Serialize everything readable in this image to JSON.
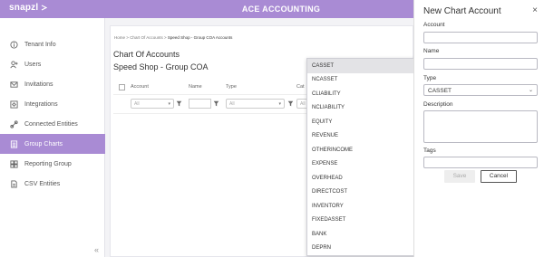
{
  "app": {
    "logo_text": "snapzl",
    "title": "ACE ACCOUNTING"
  },
  "sidebar": {
    "items": [
      {
        "label": "Tenant Info",
        "icon": "info-circle-icon"
      },
      {
        "label": "Users",
        "icon": "users-icon"
      },
      {
        "label": "Invitations",
        "icon": "invite-icon"
      },
      {
        "label": "Integrations",
        "icon": "integrations-icon"
      },
      {
        "label": "Connected Entities",
        "icon": "link-icon"
      },
      {
        "label": "Group Charts",
        "icon": "chart-list-icon",
        "active": true
      },
      {
        "label": "Reporting Group",
        "icon": "reporting-group-icon"
      },
      {
        "label": "CSV Entities",
        "icon": "csv-icon"
      }
    ],
    "collapse_glyph": "«",
    "active_color": "#a98bd4"
  },
  "breadcrumb": {
    "items": [
      "Home",
      "Chart Of Accounts",
      "Speed Shop - Group COA Accounts"
    ],
    "separator": ">"
  },
  "main": {
    "title": "Chart Of Accounts",
    "subtitle": "Speed Shop - Group COA",
    "columns": [
      "Account",
      "Name",
      "Type",
      "Cat"
    ],
    "filter_all": "All"
  },
  "dropdown": {
    "options": [
      "CASSET",
      "NCASSET",
      "CLIABILITY",
      "NCLIABILITY",
      "EQUITY",
      "REVENUE",
      "OTHERINCOME",
      "EXPENSE",
      "OVERHEAD",
      "DIRECTCOST",
      "INVENTORY",
      "FIXEDASSET",
      "BANK",
      "DEPRN"
    ],
    "selected": "CASSET"
  },
  "panel": {
    "title": "New Chart Account",
    "close_glyph": "×",
    "fields": {
      "account_label": "Account",
      "account_value": "",
      "name_label": "Name",
      "name_value": "",
      "type_label": "Type",
      "type_value": "CASSET",
      "description_label": "Description",
      "description_value": "",
      "tags_label": "Tags",
      "tags_value": ""
    },
    "save_label": "Save",
    "cancel_label": "Cancel"
  },
  "colors": {
    "brand": "#a98bd4",
    "background": "#f3f3f6"
  }
}
